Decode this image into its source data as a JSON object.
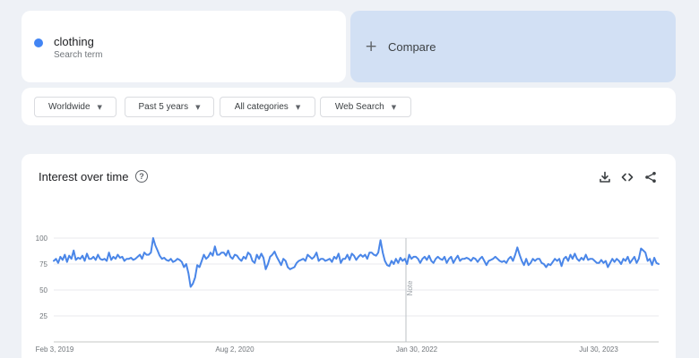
{
  "search_term": {
    "name": "clothing",
    "subtitle": "Search term",
    "color": "#4285f4"
  },
  "compare": {
    "label": "Compare"
  },
  "filters": [
    {
      "label": "Worldwide"
    },
    {
      "label": "Past 5 years"
    },
    {
      "label": "All categories"
    },
    {
      "label": "Web Search"
    }
  ],
  "card": {
    "title": "Interest over time",
    "help_icon": "help-circle-icon",
    "actions": [
      "download-icon",
      "embed-code-icon",
      "share-icon"
    ]
  },
  "chart_data": {
    "type": "line",
    "title": "Interest over time",
    "xlabel": "",
    "ylabel": "",
    "ylim": [
      0,
      100
    ],
    "yticks": [
      25,
      50,
      75,
      100
    ],
    "x_tick_labels": [
      "Feb 3, 2019",
      "Aug 2, 2020",
      "Jan 30, 2022",
      "Jul 30, 2023"
    ],
    "annotation": "Note",
    "grid": true,
    "line_color": "#4a86e8",
    "series": [
      {
        "name": "clothing",
        "values": [
          78,
          80,
          76,
          82,
          79,
          84,
          77,
          83,
          80,
          88,
          79,
          81,
          80,
          83,
          78,
          85,
          80,
          80,
          82,
          79,
          84,
          80,
          79,
          80,
          78,
          86,
          79,
          82,
          80,
          84,
          81,
          82,
          78,
          80,
          80,
          81,
          79,
          80,
          82,
          84,
          80,
          86,
          84,
          84,
          86,
          100,
          93,
          88,
          83,
          80,
          81,
          79,
          78,
          80,
          77,
          78,
          80,
          79,
          77,
          72,
          75,
          66,
          53,
          56,
          62,
          74,
          72,
          78,
          84,
          80,
          82,
          86,
          83,
          92,
          84,
          84,
          86,
          86,
          83,
          88,
          82,
          80,
          84,
          83,
          80,
          78,
          82,
          80,
          86,
          84,
          78,
          76,
          84,
          80,
          85,
          81,
          70,
          75,
          82,
          84,
          87,
          82,
          78,
          74,
          80,
          78,
          72,
          70,
          71,
          72,
          76,
          78,
          79,
          80,
          78,
          84,
          82,
          80,
          82,
          86,
          78,
          80,
          80,
          78,
          79,
          80,
          77,
          82,
          80,
          85,
          76,
          80,
          80,
          84,
          79,
          85,
          83,
          79,
          82,
          84,
          82,
          84,
          80,
          86,
          86,
          84,
          83,
          86,
          98,
          86,
          78,
          74,
          73,
          78,
          75,
          80,
          76,
          81,
          78,
          80,
          75,
          84,
          80,
          82,
          82,
          80,
          76,
          80,
          82,
          79,
          83,
          78,
          76,
          80,
          82,
          80,
          79,
          82,
          76,
          80,
          82,
          76,
          80,
          83,
          78,
          80,
          80,
          81,
          80,
          78,
          81,
          80,
          77,
          80,
          82,
          78,
          74,
          78,
          79,
          80,
          82,
          80,
          78,
          77,
          78,
          76,
          80,
          82,
          78,
          84,
          91,
          84,
          78,
          74,
          80,
          74,
          76,
          80,
          78,
          80,
          80,
          76,
          75,
          72,
          75,
          74,
          77,
          80,
          78,
          80,
          73,
          80,
          82,
          78,
          84,
          80,
          85,
          80,
          78,
          81,
          79,
          84,
          79,
          80,
          80,
          78,
          76,
          76,
          79,
          76,
          78,
          72,
          76,
          80,
          77,
          80,
          78,
          75,
          80,
          78,
          82,
          76,
          79,
          82,
          76,
          80,
          90,
          88,
          86,
          78,
          80,
          74,
          81,
          76,
          75
        ]
      }
    ]
  }
}
